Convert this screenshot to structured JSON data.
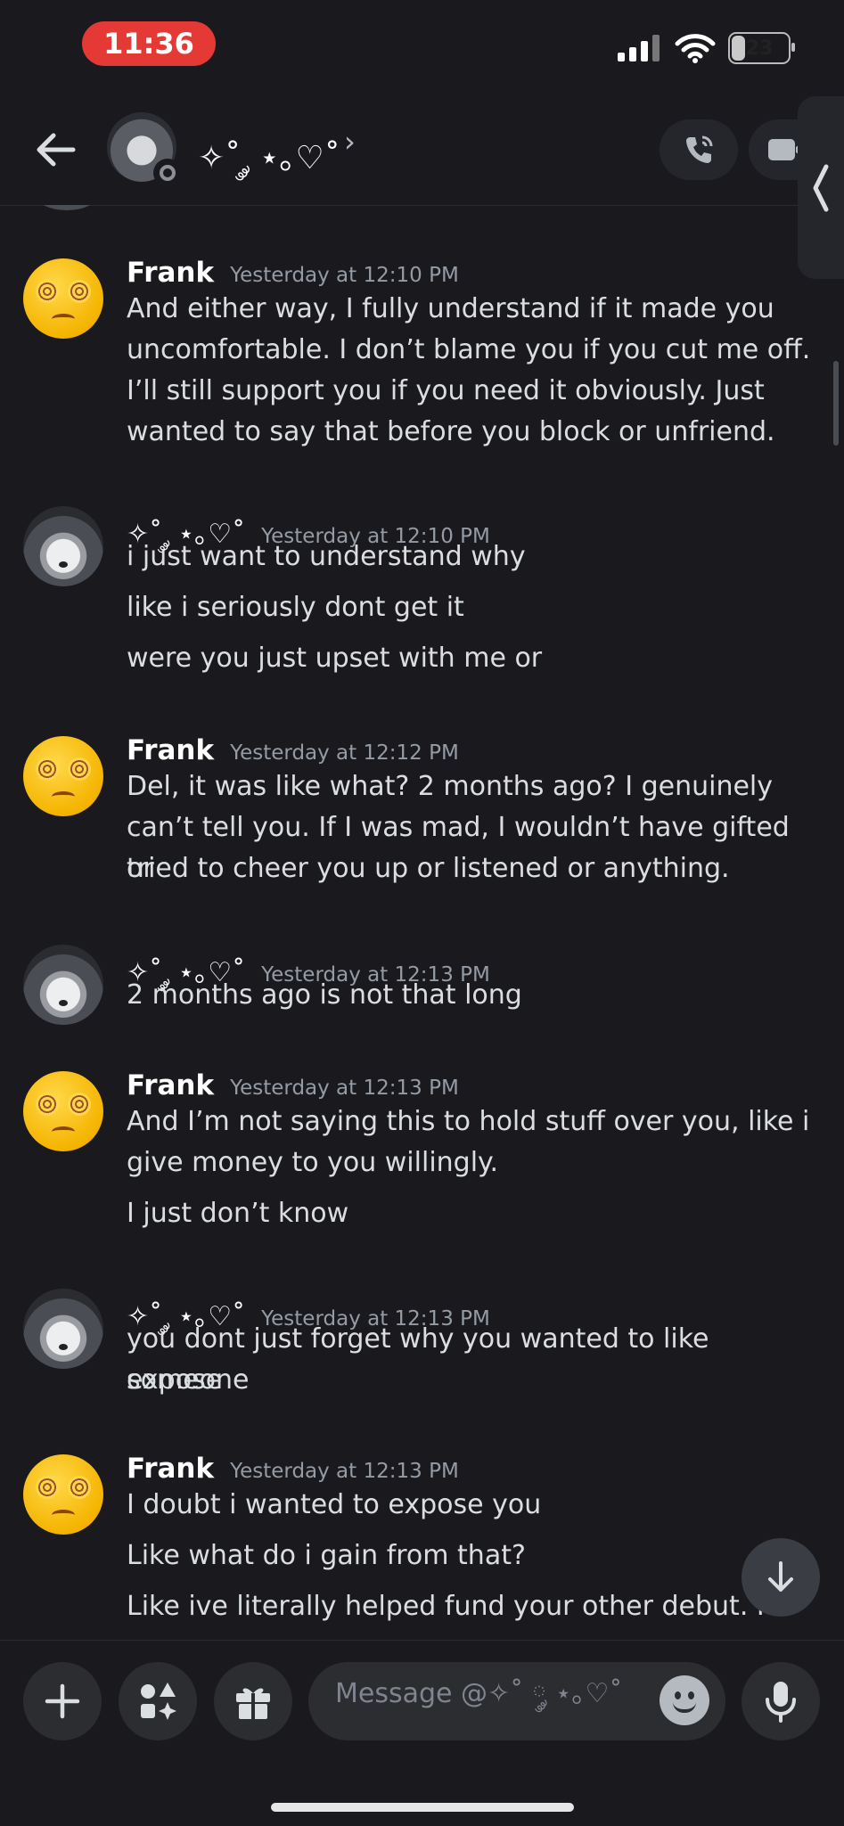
{
  "status_bar": {
    "time": "11:36",
    "battery": "23",
    "battery_level": 0.23
  },
  "header": {
    "channel_name": "✧˚ ༘ ⋆｡♡˚",
    "chevron": "›"
  },
  "messages": [
    {
      "author": "Frank",
      "author_type": "frank",
      "timestamp": "Yesterday at 12:10 PM",
      "lines": [
        "And either way, I fully understand if it made you",
        "uncomfortable. I don’t blame you if you cut me off.",
        "I’ll still support you if you need it obviously. Just",
        "wanted to say that before you block or unfriend."
      ]
    },
    {
      "author": "✧˚ ༘ ⋆｡♡˚",
      "author_type": "hood",
      "timestamp": "Yesterday at 12:10 PM",
      "lines": [
        "i just want to understand why",
        "like i seriously dont get it",
        "were you just upset with me or"
      ]
    },
    {
      "author": "Frank",
      "author_type": "frank",
      "timestamp": "Yesterday at 12:12 PM",
      "lines": [
        "Del, it was like what? 2 months ago? I genuinely",
        "can’t tell you. If I was mad, I wouldn’t have gifted or",
        "tried to cheer you up or listened or anything."
      ]
    },
    {
      "author": "✧˚ ༘ ⋆｡♡˚",
      "author_type": "hood",
      "timestamp": "Yesterday at 12:13 PM",
      "lines": [
        "2 months ago is not that long"
      ]
    },
    {
      "author": "Frank",
      "author_type": "frank",
      "timestamp": "Yesterday at 12:13 PM",
      "lines": [
        "And I’m not saying this to hold stuff over you, like i",
        "give money to you willingly.",
        "I just don’t know"
      ]
    },
    {
      "author": "✧˚ ༘ ⋆｡♡˚",
      "author_type": "hood",
      "timestamp": "Yesterday at 12:13 PM",
      "lines": [
        "you dont just forget why you wanted to like expose",
        "someone"
      ]
    },
    {
      "author": "Frank",
      "author_type": "frank",
      "timestamp": "Yesterday at 12:13 PM",
      "lines": [
        "I doubt i wanted to expose you",
        "Like what do i gain from that?",
        "Like ive literally helped fund your other debut. It"
      ]
    }
  ],
  "composer": {
    "placeholder": "Message @✧˚ ༘ ⋆｡♡˚"
  },
  "icons": {
    "back": "arrow-left-icon",
    "call": "phone-call-icon",
    "video": "video-camera-icon",
    "side_tab": "chevron-left-icon",
    "scroll_down": "arrow-down-icon",
    "add": "plus-icon",
    "apps": "apps-icon",
    "gift": "gift-icon",
    "emoji": "emoji-icon",
    "mic": "microphone-icon"
  },
  "colors": {
    "background": "#1a1a1e",
    "time_pill": "#e53935",
    "text": "#dbdee1",
    "timestamp": "#949ba4"
  }
}
